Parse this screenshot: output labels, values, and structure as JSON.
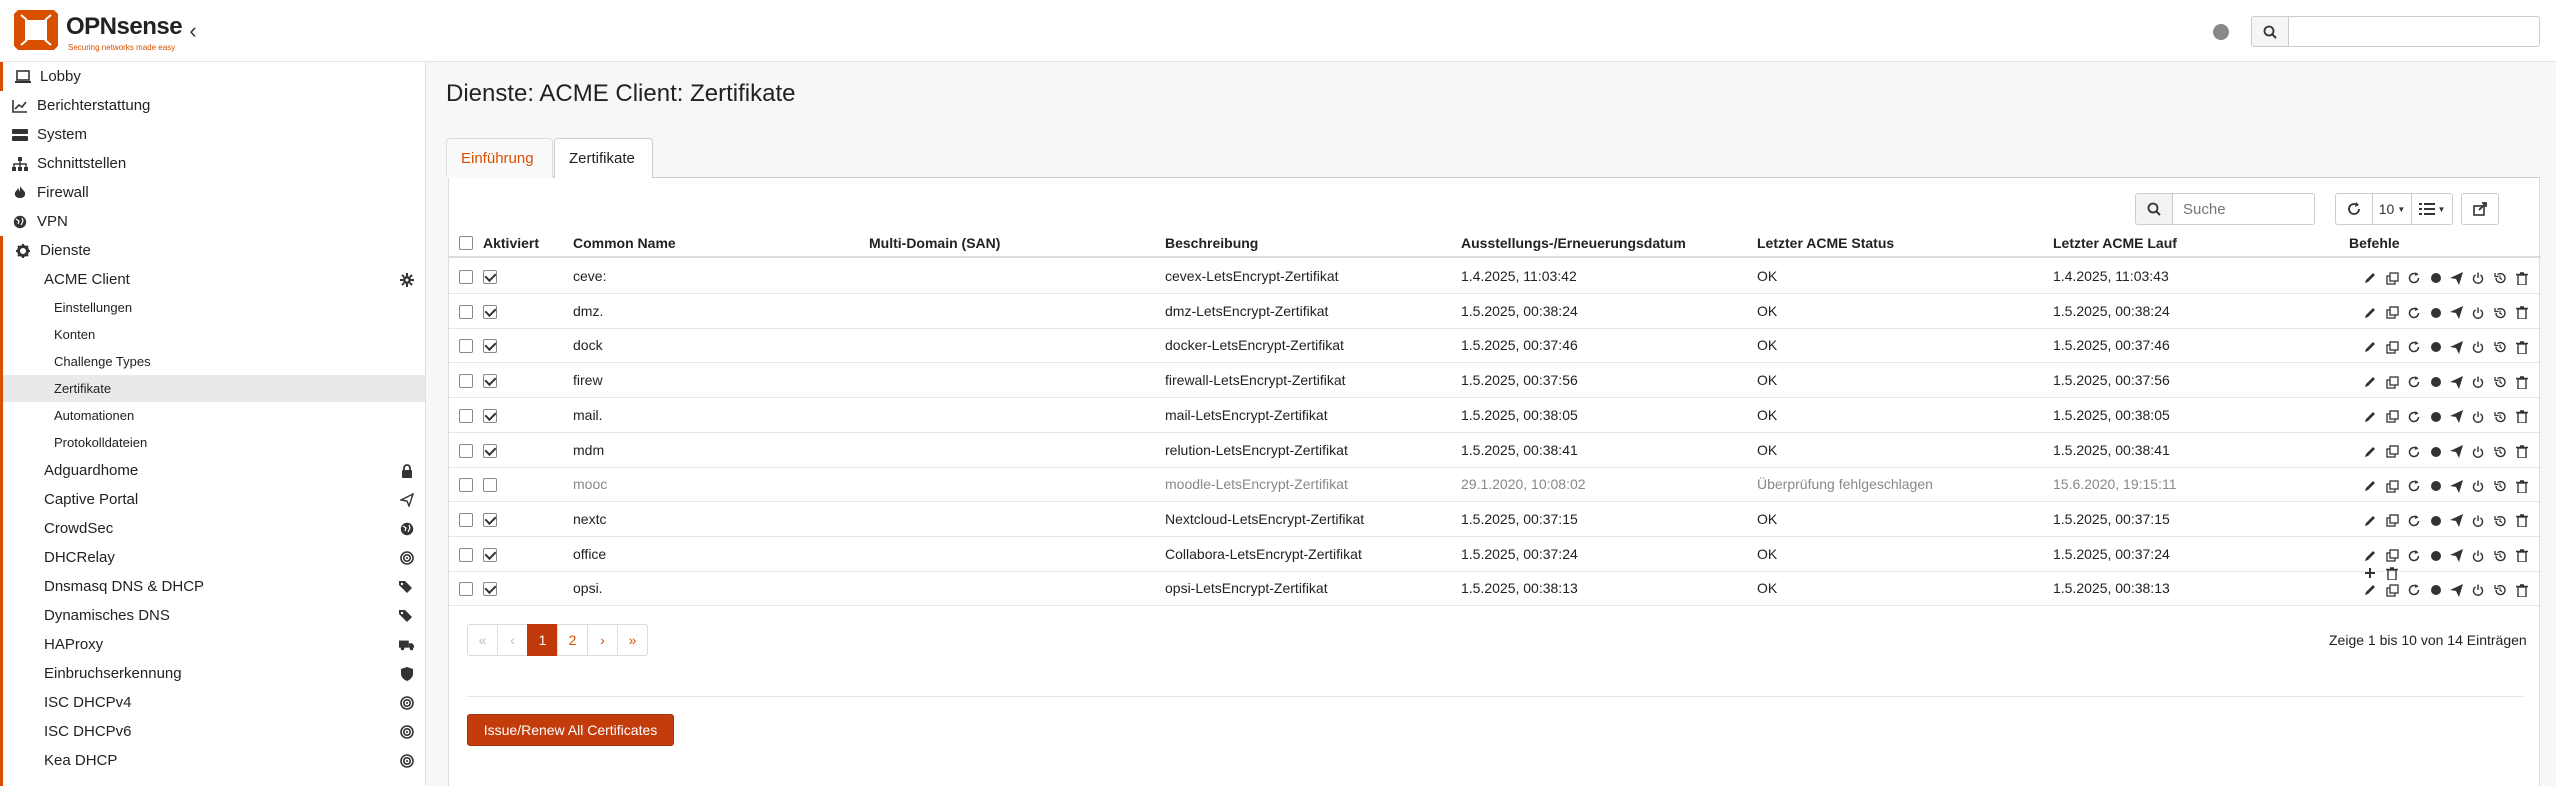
{
  "brand": {
    "name": "OPNsense",
    "tagline": "Securing networks made easy",
    "color": "#d94f00"
  },
  "header": {
    "search_placeholder": ""
  },
  "sidebar": {
    "items": [
      {
        "label": "Lobby",
        "icon": "laptop-icon"
      },
      {
        "label": "Berichterstattung",
        "icon": "chart-icon"
      },
      {
        "label": "System",
        "icon": "server-icon"
      },
      {
        "label": "Schnittstellen",
        "icon": "sitemap-icon"
      },
      {
        "label": "Firewall",
        "icon": "fire-icon"
      },
      {
        "label": "VPN",
        "icon": "globe-icon"
      },
      {
        "label": "Dienste",
        "icon": "gear-icon"
      }
    ],
    "dienste_children": [
      {
        "label": "ACME Client",
        "icon": "cog-icon"
      },
      {
        "label": "Adguardhome",
        "icon": "lock-icon"
      },
      {
        "label": "Captive Portal",
        "icon": "paper-plane-icon"
      },
      {
        "label": "CrowdSec",
        "icon": "globe-icon"
      },
      {
        "label": "DHCRelay",
        "icon": "bullseye-icon"
      },
      {
        "label": "Dnsmasq DNS & DHCP",
        "icon": "tags-icon"
      },
      {
        "label": "Dynamisches DNS",
        "icon": "tags-icon"
      },
      {
        "label": "HAProxy",
        "icon": "truck-icon"
      },
      {
        "label": "Einbruchserkennung",
        "icon": "shield-icon"
      },
      {
        "label": "ISC DHCPv4",
        "icon": "bullseye-icon"
      },
      {
        "label": "ISC DHCPv6",
        "icon": "bullseye-icon"
      },
      {
        "label": "Kea DHCP",
        "icon": "bullseye-icon"
      }
    ],
    "acme_children": [
      {
        "label": "Einstellungen",
        "active": false
      },
      {
        "label": "Konten",
        "active": false
      },
      {
        "label": "Challenge Types",
        "active": false
      },
      {
        "label": "Zertifikate",
        "active": true
      },
      {
        "label": "Automationen",
        "active": false
      },
      {
        "label": "Protokolldateien",
        "active": false
      }
    ]
  },
  "page": {
    "title": "Dienste: ACME Client: Zertifikate",
    "tabs": [
      {
        "label": "Einführung",
        "active": false
      },
      {
        "label": "Zertifikate",
        "active": true
      }
    ]
  },
  "toolbar": {
    "search_placeholder": "Suche",
    "page_size": "10"
  },
  "table": {
    "columns": [
      "Aktiviert",
      "Common Name",
      "Multi-Domain (SAN)",
      "Beschreibung",
      "Ausstellungs-/Erneuerungsdatum",
      "Letzter ACME Status",
      "Letzter ACME Lauf",
      "Befehle"
    ],
    "rows": [
      {
        "enabled": true,
        "common_name": "ceve:",
        "san": "",
        "description": "cevex-LetsEncrypt-Zertifikat",
        "issued": "1.4.2025, 11:03:42",
        "status": "OK",
        "last_run": "1.4.2025, 11:03:43"
      },
      {
        "enabled": true,
        "common_name": "dmz.",
        "san": "",
        "description": "dmz-LetsEncrypt-Zertifikat",
        "issued": "1.5.2025, 00:38:24",
        "status": "OK",
        "last_run": "1.5.2025, 00:38:24"
      },
      {
        "enabled": true,
        "common_name": "dock",
        "san": "",
        "description": "docker-LetsEncrypt-Zertifikat",
        "issued": "1.5.2025, 00:37:46",
        "status": "OK",
        "last_run": "1.5.2025, 00:37:46"
      },
      {
        "enabled": true,
        "common_name": "firew",
        "san": "",
        "description": "firewall-LetsEncrypt-Zertifikat",
        "issued": "1.5.2025, 00:37:56",
        "status": "OK",
        "last_run": "1.5.2025, 00:37:56"
      },
      {
        "enabled": true,
        "common_name": "mail.",
        "san": "",
        "description": "mail-LetsEncrypt-Zertifikat",
        "issued": "1.5.2025, 00:38:05",
        "status": "OK",
        "last_run": "1.5.2025, 00:38:05"
      },
      {
        "enabled": true,
        "common_name": "mdm",
        "san": "",
        "description": "relution-LetsEncrypt-Zertifikat",
        "issued": "1.5.2025, 00:38:41",
        "status": "OK",
        "last_run": "1.5.2025, 00:38:41"
      },
      {
        "enabled": false,
        "common_name": "mooc",
        "san": "",
        "description": "moodle-LetsEncrypt-Zertifikat",
        "issued": "29.1.2020, 10:08:02",
        "status": "Überprüfung fehlgeschlagen",
        "last_run": "15.6.2020, 19:15:11"
      },
      {
        "enabled": true,
        "common_name": "nextc",
        "san": "",
        "description": "Nextcloud-LetsEncrypt-Zertifikat",
        "issued": "1.5.2025, 00:37:15",
        "status": "OK",
        "last_run": "1.5.2025, 00:37:15"
      },
      {
        "enabled": true,
        "common_name": "office",
        "san": "",
        "description": "Collabora-LetsEncrypt-Zertifikat",
        "issued": "1.5.2025, 00:37:24",
        "status": "OK",
        "last_run": "1.5.2025, 00:37:24"
      },
      {
        "enabled": true,
        "common_name": "opsi.",
        "san": "",
        "description": "opsi-LetsEncrypt-Zertifikat",
        "issued": "1.5.2025, 00:38:13",
        "status": "OK",
        "last_run": "1.5.2025, 00:38:13"
      }
    ],
    "row_commands": [
      "pencil-icon",
      "copy-icon",
      "refresh-icon",
      "circle-icon",
      "paper-plane-icon",
      "power-icon",
      "history-icon",
      "trash-icon"
    ]
  },
  "pagination": {
    "first": "«",
    "prev": "‹",
    "pages": [
      "1",
      "2"
    ],
    "current": "1",
    "next": "›",
    "last": "»",
    "info": "Zeige 1 bis 10 von 14 Einträgen"
  },
  "actions": {
    "issue_all": "Issue/Renew All Certificates"
  }
}
